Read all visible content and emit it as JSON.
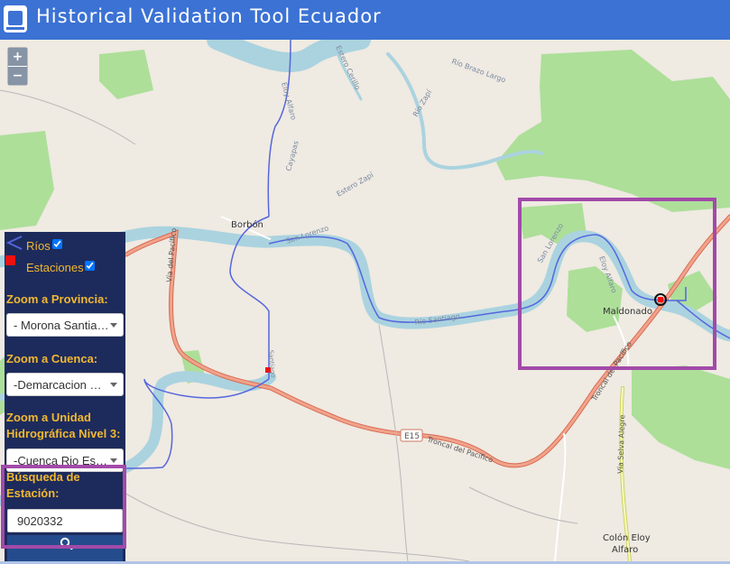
{
  "app": {
    "title": "Historical Validation Tool Ecuador"
  },
  "zoom": {
    "plus": "+",
    "minus": "−"
  },
  "legend": {
    "rios": "Ríos",
    "estaciones": "Estaciones",
    "rios_checked": true,
    "estaciones_checked": true
  },
  "panel": {
    "provincia_label": "Zoom a Provincia:",
    "provincia_value": "- Morona Santia…",
    "cuenca_label": "Zoom a Cuenca:",
    "cuenca_value": "-Demarcacion …",
    "unidad_label": "Zoom a Unidad Hidrográfica Nivel 3:",
    "unidad_value": "-Cuenca Rio Es…",
    "busqueda_label": "Búsqueda de Estación:",
    "search_value": "9020332"
  },
  "map_labels": {
    "borbon": "Borbón",
    "maldonado": "Maldonado",
    "colon_1": "Colón Eloy",
    "colon_2": "Alfaro",
    "e15": "E15",
    "troncal": "Troncal del Pacífico",
    "troncal2": "Troncal del Pacífico",
    "via_pacifico": "Vía del Pacífico",
    "via_selva": "Vía Selva Alegre",
    "san_lorenzo": "San Lorenzo",
    "san_lorenzo2": "San Lorenzo",
    "rio_santiago": "Río Santiago",
    "rio_zapi": "Río Zapí",
    "estero_zapi": "Estero Zapí",
    "rio_brazo": "Río Brazo Largo",
    "estero_cerillo": "Estero Cerillo",
    "eloy_alfaro": "Eloy Alfaro",
    "eloy_alfaro2": "Eloy Alfaro",
    "cayapas": "Cayapas",
    "santiago_small": "Santiago"
  },
  "colors": {
    "header": "#3b72d4",
    "panel": "#1d2b5c",
    "accent": "#f2b830",
    "highlight": "#a24aa9",
    "river": "#5566dd",
    "water": "#aad3df",
    "forest": "#addf99",
    "road": "#e8927c"
  }
}
